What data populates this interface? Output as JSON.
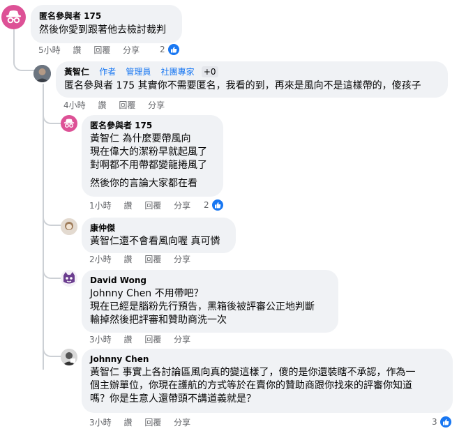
{
  "actions": {
    "like": "讚",
    "reply": "回覆",
    "share": "分享"
  },
  "comments": [
    {
      "name": "匿名參與者 175",
      "lines": [
        "然後你愛到跟著他去檢討裁判"
      ],
      "time": "5小時",
      "reactions": "2"
    },
    {
      "name": "黃智仁",
      "badges": [
        "作者",
        "管理員",
        "社團專家"
      ],
      "plus": "+0",
      "lines": [
        "匿名參與者 175 其實你不需要匿名，我看的到，再來是風向不是這樣帶的，傻孩子"
      ],
      "time": "4小時"
    },
    {
      "name": "匿名參與者 175",
      "lines": [
        "黃智仁 為什麼要帶風向",
        "現在偉大的潔粉早就起風了",
        "對啊都不用帶都變龍捲風了",
        "然後你的言論大家都在看"
      ],
      "time": "1小時",
      "reactions": "2"
    },
    {
      "name": "康仲傑",
      "lines": [
        "黃智仁還不會看風向喔 真可憐"
      ],
      "time": "2小時"
    },
    {
      "name": "David Wong",
      "lines": [
        "Johnny Chen 不用帶吧？",
        "現在已經是腦粉先行預告，黑箱後被評審公正地判斷",
        "輸掉然後把評審和贊助商洗一次"
      ],
      "time": "3小時"
    },
    {
      "name": "Johnny Chen",
      "lines": [
        "黃智仁 事實上各討論區風向真的變這樣了，傻的是你還裝瞎不承認，作為一",
        "個主辦單位，你現在護航的方式等於在賣你的贊助商跟你找來的評審你知道",
        "嗎？你是生意人還帶頭不講道義就是？"
      ],
      "time": "3小時",
      "reactions": "3"
    }
  ]
}
